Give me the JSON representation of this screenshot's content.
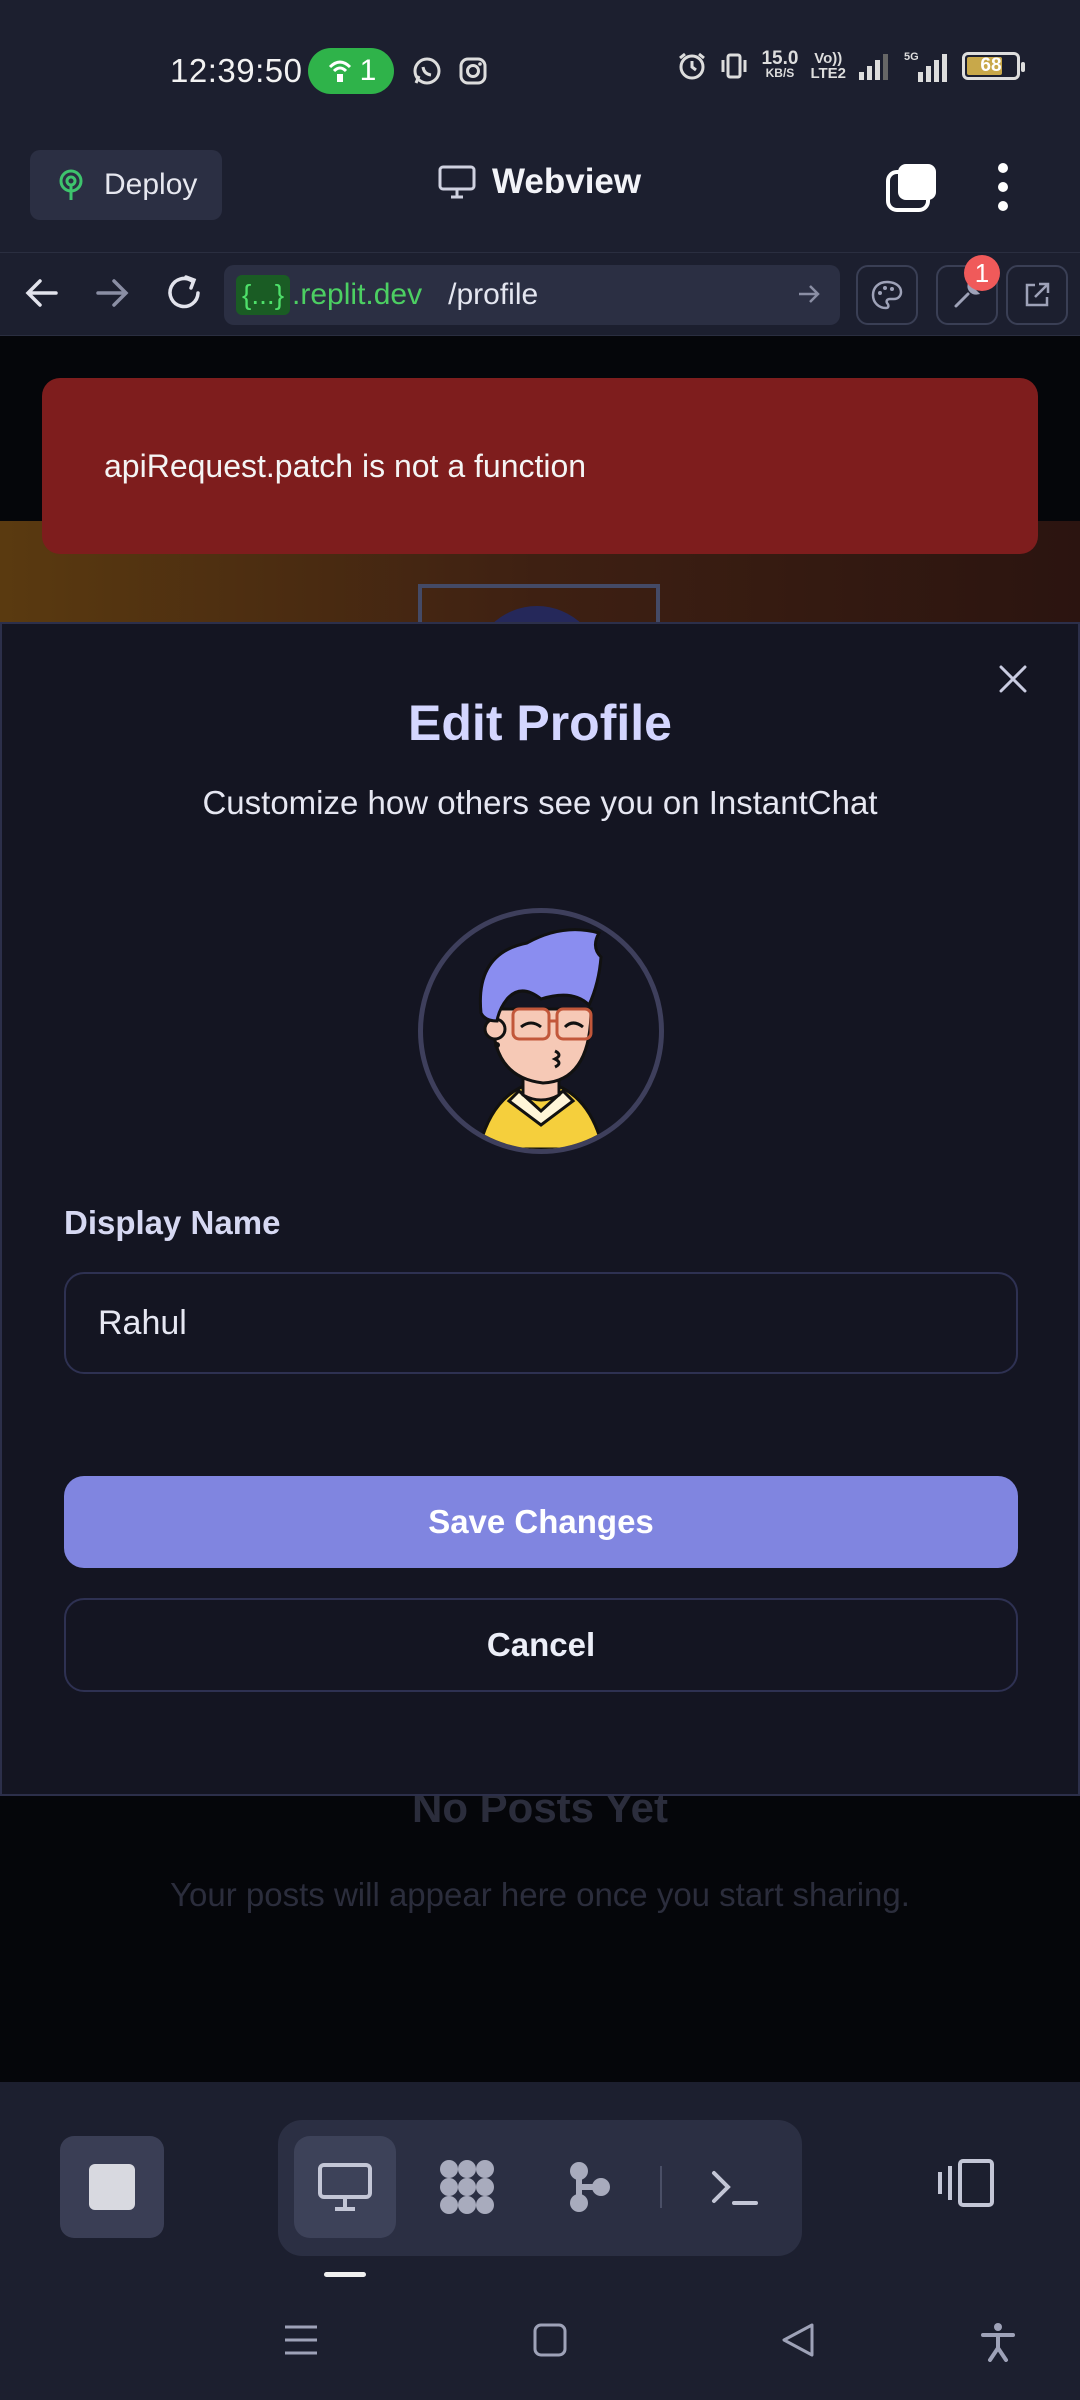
{
  "status_bar": {
    "time": "12:39:50",
    "hotspot_count": "1",
    "net_speed": "15.0",
    "net_unit": "KB/S",
    "volte_top": "Vo))",
    "volte_bottom": "LTE2",
    "battery": "68"
  },
  "header": {
    "deploy_label": "Deploy",
    "title": "Webview"
  },
  "url_bar": {
    "prefix": "{...}",
    "domain": ".replit.dev",
    "path": "/profile",
    "devtools_badge": "1"
  },
  "toast": {
    "message": "apiRequest.patch is not a function"
  },
  "modal": {
    "title": "Edit Profile",
    "subtitle": "Customize how others see you on InstantChat",
    "display_name_label": "Display Name",
    "display_name_value": "Rahul",
    "save_label": "Save Changes",
    "cancel_label": "Cancel"
  },
  "background_page": {
    "empty_title": "No Posts Yet",
    "empty_subtitle": "Your posts will appear here once you start sharing."
  },
  "colors": {
    "accent": "#8085e0",
    "error": "#7e1d1d",
    "url_green": "#4ccf62"
  }
}
